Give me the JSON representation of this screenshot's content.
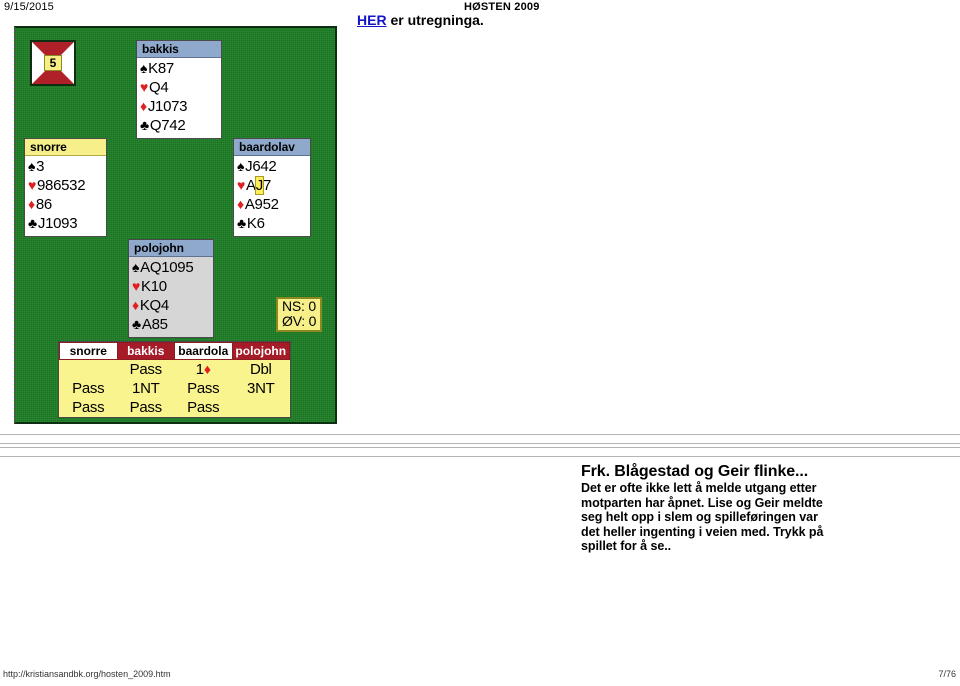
{
  "page_header": {
    "date": "9/15/2015",
    "title": "HØSTEN 2009"
  },
  "intro": {
    "link_text": "HER",
    "rest_text": " er utregninga."
  },
  "deal": {
    "board_number": "5",
    "score": {
      "ns": "NS: 0",
      "ov": "ØV: 0"
    },
    "hands": {
      "north": {
        "player": "bakkis",
        "spades": "K87",
        "hearts": "Q4",
        "diamonds": "J1073",
        "clubs": "Q742"
      },
      "west": {
        "player": "snorre",
        "spades": "3",
        "hearts": "986532",
        "diamonds": "86",
        "clubs": "J1093"
      },
      "east": {
        "player": "baardolav",
        "spades": "J642",
        "hearts_pre": "A",
        "hearts_hi": "J",
        "hearts_post": "7",
        "diamonds": "A952",
        "clubs": "K6"
      },
      "south": {
        "player": "polojohn",
        "spades": "AQ1095",
        "hearts": "K10",
        "diamonds": "KQ4",
        "clubs": "A85"
      }
    },
    "pips": {
      "spade": "♠",
      "heart": "♥",
      "diamond": "♦",
      "club": "♣"
    },
    "bidding": {
      "headers": [
        "snorre",
        "bakkis",
        "baardola",
        "polojohn"
      ],
      "rows": [
        [
          "",
          "Pass",
          "1",
          "Dbl"
        ],
        [
          "Pass",
          "1NT",
          "Pass",
          "3NT"
        ],
        [
          "Pass",
          "Pass",
          "Pass",
          ""
        ]
      ],
      "diamond_symbol": "♦"
    }
  },
  "article": {
    "heading": "Frk. Blågestad og Geir flinke...",
    "body": "Det er ofte ikke lett å melde utgang etter motparten har åpnet. Lise og Geir meldte seg helt opp i slem og spilleføringen var det heller ingenting i veien med. Trykk på spillet for å se.."
  },
  "footer": {
    "url": "http://kristiansandbk.org/hosten_2009.htm",
    "page": "7/76"
  }
}
